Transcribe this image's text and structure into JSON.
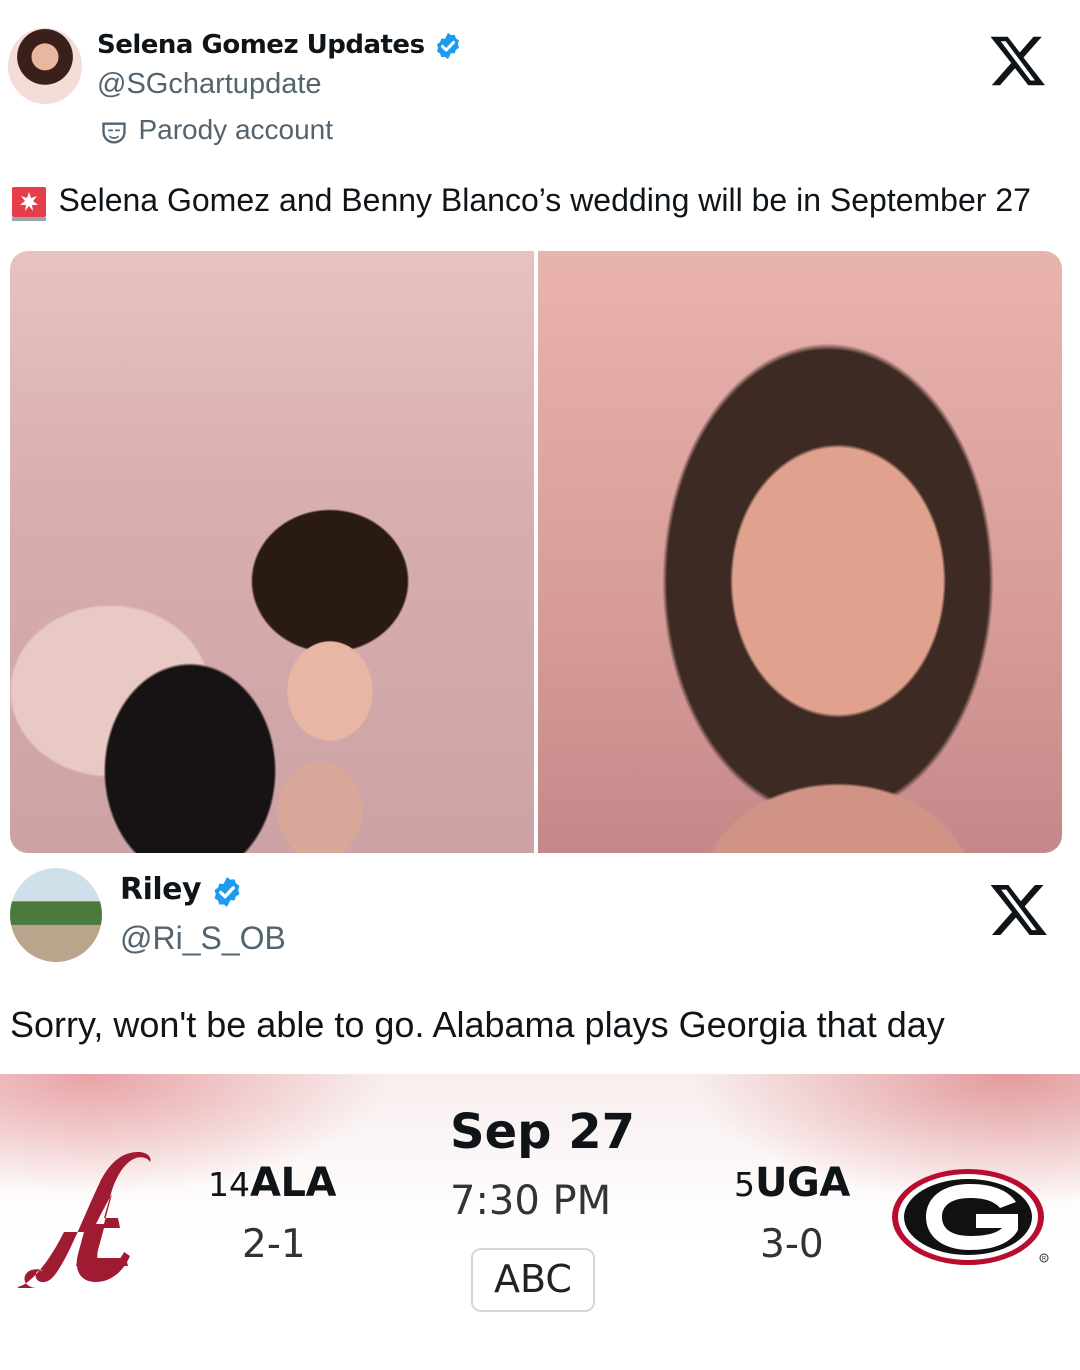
{
  "tweet1": {
    "author_name": "Selena Gomez Updates",
    "handle": "@SGchartupdate",
    "label": "Parody account",
    "label_icon": "theater-mask-icon",
    "text": "Selena Gomez and Benny Blanco’s wedding will be in September 27",
    "alert_icon": "siren-icon",
    "verified_color": "#1d9bf0"
  },
  "tweet2": {
    "author_name": "Riley",
    "handle": "@Ri_S_OB",
    "text": "Sorry, won't be able to go. Alabama plays Georgia that day",
    "verified_color": "#1d9bf0"
  },
  "game": {
    "date": "Sep 27",
    "time": "7:30 PM",
    "network": "ABC",
    "home": {
      "rank": "14",
      "abbr": "ALA",
      "record": "2-1",
      "logo_icon": "alabama-a-logo",
      "color": "#9e1b32"
    },
    "away": {
      "rank": "5",
      "abbr": "UGA",
      "record": "3-0",
      "logo_icon": "georgia-g-logo",
      "color": "#ba0c2f"
    }
  }
}
